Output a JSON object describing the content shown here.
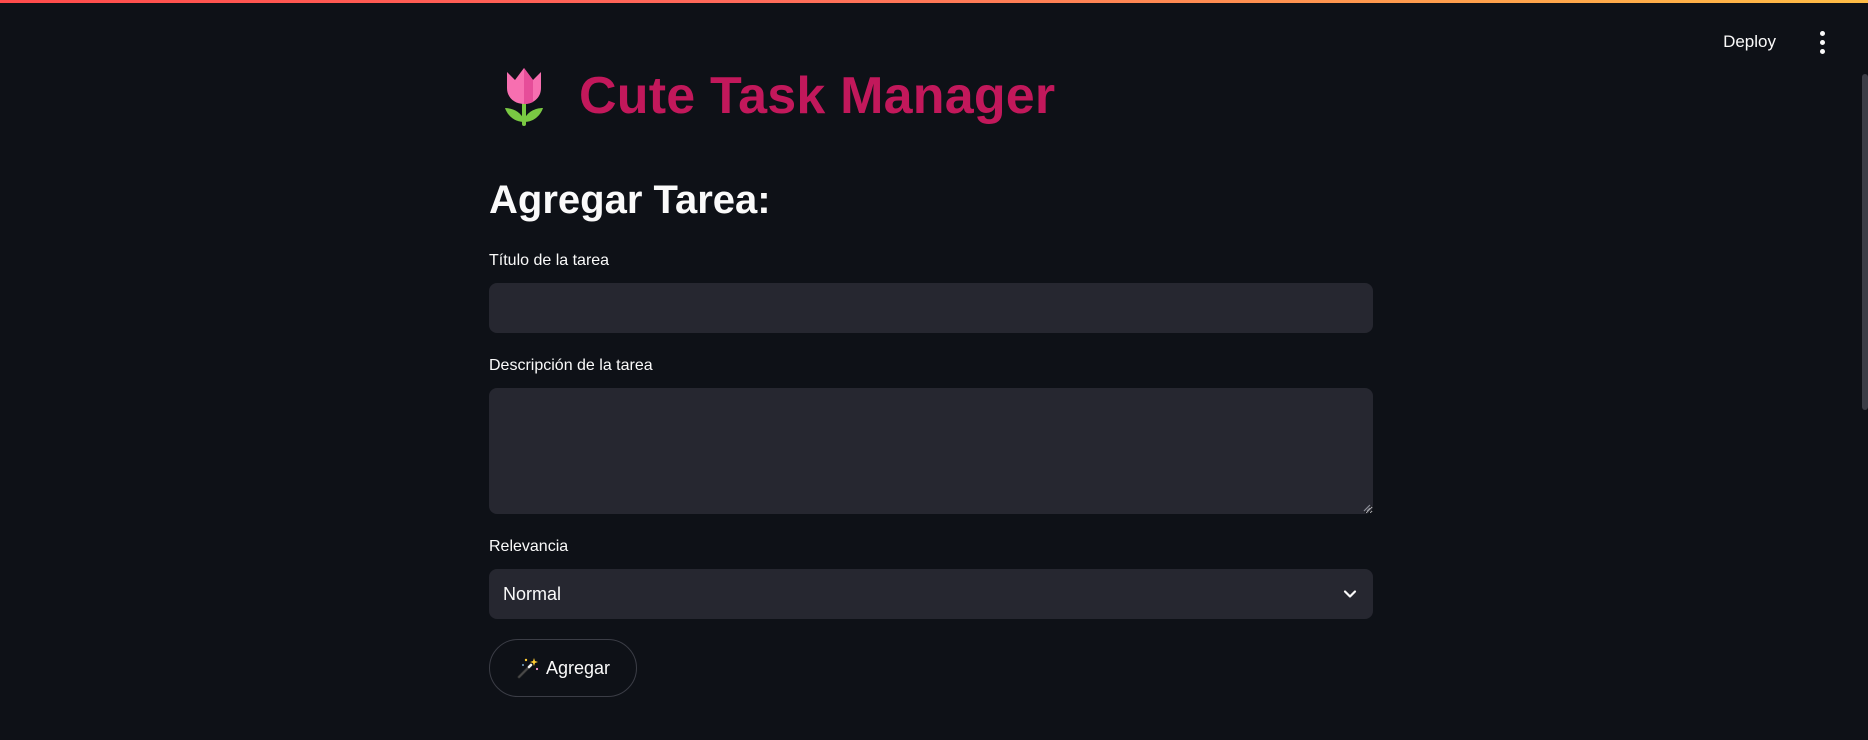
{
  "header": {
    "deploy_label": "Deploy",
    "menu_icon": "vertical-dots-icon"
  },
  "app": {
    "title": "Cute Task Manager",
    "title_icon": "tulip-icon",
    "title_color": "#c2185b"
  },
  "form": {
    "section_title": "Agregar Tarea:",
    "title_field": {
      "label": "Título de la tarea",
      "value": "",
      "placeholder": ""
    },
    "description_field": {
      "label": "Descripción de la tarea",
      "value": "",
      "placeholder": ""
    },
    "relevance_field": {
      "label": "Relevancia",
      "selected": "Normal"
    },
    "submit": {
      "label": "Agregar",
      "icon": "magic-wand-icon"
    }
  },
  "theme": {
    "background": "#0e1117",
    "input_background": "#262730",
    "text": "#fafafa",
    "accent": "#ff4b4b"
  }
}
